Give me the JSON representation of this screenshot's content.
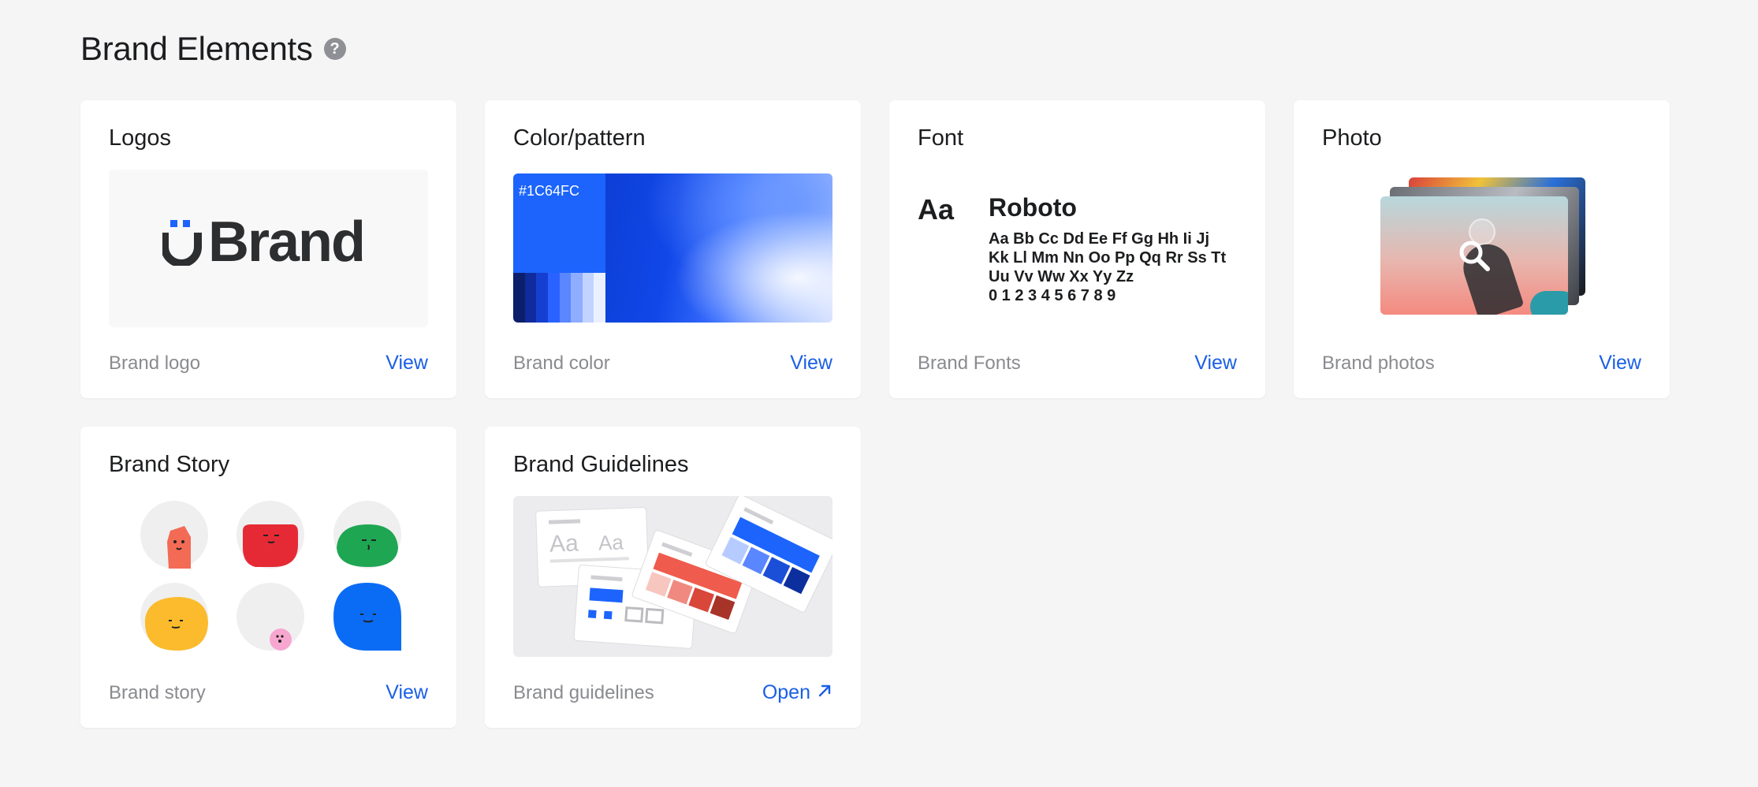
{
  "page": {
    "title": "Brand Elements",
    "help_icon": "question-circle-icon"
  },
  "cards": {
    "logos": {
      "title": "Logos",
      "footer_label": "Brand logo",
      "action": "View",
      "logo_text": "Brand"
    },
    "color": {
      "title": "Color/pattern",
      "footer_label": "Brand color",
      "action": "View",
      "primary_hex": "#1C64FC",
      "palette": [
        "#0b1f6b",
        "#102c9c",
        "#153fd1",
        "#2a62ff",
        "#5a86ff",
        "#8eadff",
        "#c2d3ff",
        "#eaf0ff"
      ]
    },
    "font": {
      "title": "Font",
      "footer_label": "Brand Fonts",
      "action": "View",
      "sample_aa": "Aa",
      "font_name": "Roboto",
      "sample_lines": [
        "Aa Bb Cc Dd Ee Ff Gg Hh Ii Jj",
        "Kk Ll Mm Nn Oo Pp Qq Rr Ss Tt",
        "Uu Vv Ww Xx Yy Zz",
        "0 1 2 3 4 5 6 7 8 9"
      ]
    },
    "photo": {
      "title": "Photo",
      "footer_label": "Brand photos",
      "action": "View"
    },
    "story": {
      "title": "Brand Story",
      "footer_label": "Brand story",
      "action": "View"
    },
    "guidelines": {
      "title": "Brand Guidelines",
      "footer_label": "Brand guidelines",
      "action": "Open",
      "action_icon": "external-arrow-icon"
    }
  },
  "colors": {
    "link": "#1a5fe6",
    "brand_blue": "#1c64fc"
  }
}
